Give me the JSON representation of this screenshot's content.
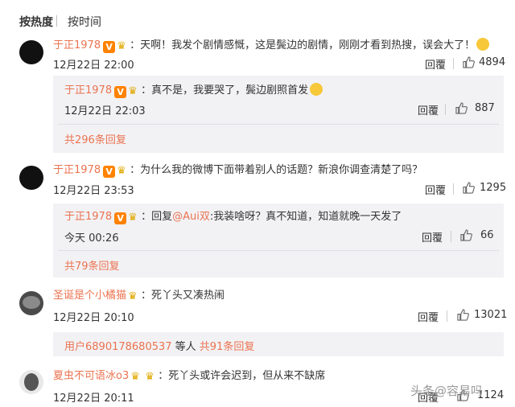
{
  "sort": {
    "hot": "按热度",
    "time": "按时间"
  },
  "reply_label": "回覆",
  "c1": {
    "user": "于正1978",
    "v": "V",
    "colon": "：",
    "text": "天啊！我发个剧情感慨，这是鬓边的剧情，刚刚才看到热搜，误会大了！",
    "time": "12月22日 22:00",
    "likes": "4894"
  },
  "c1r": {
    "user": "于正1978",
    "v": "V",
    "colon": "：",
    "text": "真不是，我要哭了，鬓边剧照首发",
    "time": "12月22日 22:03",
    "likes": "887",
    "more": "共296条回复"
  },
  "c2": {
    "user": "于正1978",
    "v": "V",
    "colon": "：",
    "text": "为什么我的微博下面带着别人的话题？新浪你调查清楚了吗？",
    "time": "12月22日 23:53",
    "likes": "1295"
  },
  "c2r": {
    "user": "于正1978",
    "v": "V",
    "colon": "：",
    "prefix": "回复",
    "mention": "@Aui双",
    "text": ":我装啥呀？真不知道，知道就晚一天发了",
    "time": "今天 00:26",
    "likes": "66",
    "more": "共79条回复"
  },
  "c3": {
    "user": "圣诞是个小橘猫",
    "colon": "：",
    "text": "死丫头又凑热闹",
    "time": "12月22日 20:10",
    "likes": "13021",
    "more_user": "用户6890178680537",
    "more_mid": " 等人 ",
    "more": "共91条回复"
  },
  "c4": {
    "user": "夏虫不可语冰o3",
    "colon": "：",
    "text": "死丫头或许会迟到，但从来不缺席",
    "time": "12月22日 20:11",
    "likes": "1124"
  },
  "watermark": "头条@容易吗"
}
